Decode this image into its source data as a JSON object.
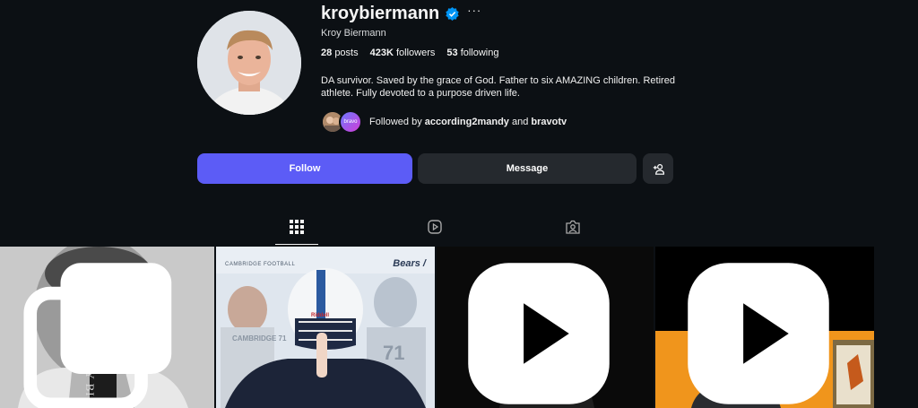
{
  "profile": {
    "username": "kroybiermann",
    "more_label": "···",
    "full_name": "Kroy Biermann",
    "stats": {
      "posts_count": "28",
      "posts_label": "posts",
      "followers_count": "423K",
      "followers_label": "followers",
      "following_count": "53",
      "following_label": "following"
    },
    "bio": "DA survivor. Saved by the grace of God. Father to six AMAZING children. Retired athlete. Fully devoted to a purpose driven life.",
    "followed_by": {
      "prefix": "Followed by",
      "user1": "according2mandy",
      "conjunction": "and",
      "user2": "bravotv",
      "mini_avatar_text": "bravo"
    }
  },
  "actions": {
    "follow_label": "Follow",
    "message_label": "Message"
  },
  "tabs": [
    {
      "icon": "grid-icon",
      "active": true
    },
    {
      "icon": "reels-icon",
      "active": false
    },
    {
      "icon": "tagged-icon",
      "active": false
    }
  ],
  "posts": [
    {
      "type": "carousel",
      "text": "HOLY BI"
    },
    {
      "type": "image",
      "header": "CAMBRIDGE FOOTBALL",
      "brand": "Bears /",
      "helmet": "Riddell",
      "jersey1": "CAMBRIDGE 71",
      "jersey2": "71"
    },
    {
      "type": "reel"
    },
    {
      "type": "reel"
    }
  ],
  "colors": {
    "background": "#0c1014",
    "follow_button": "#5c5cf6",
    "secondary_button": "#25292e",
    "verified": "#0095f6"
  }
}
